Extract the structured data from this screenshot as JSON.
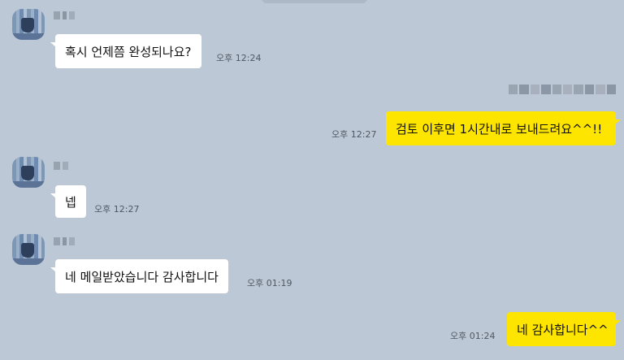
{
  "messages": [
    {
      "direction": "in",
      "sender": "redacted",
      "text": "혹시 언제쯤 완성되나요?",
      "time": "오후 12:24"
    },
    {
      "direction": "out",
      "sender": "redacted",
      "text": "검토 이후면 1시간내로 보내드려요^^!!",
      "time": "오후 12:27"
    },
    {
      "direction": "in",
      "sender": "redacted",
      "text": "넵",
      "time": "오후 12:27"
    },
    {
      "direction": "in",
      "sender": "redacted",
      "text": "네 메일받았습니다 감사합니다",
      "time": "오후 01:19"
    },
    {
      "direction": "out",
      "sender": "",
      "text": "네 감사합니다^^",
      "time": "오후 01:24"
    }
  ],
  "colors": {
    "background": "#bdc8d6",
    "incoming_bubble": "#ffffff",
    "outgoing_bubble": "#fee500",
    "time_text": "#505861"
  },
  "icons": {
    "avatar": "profile-avatar (pixelated)"
  }
}
